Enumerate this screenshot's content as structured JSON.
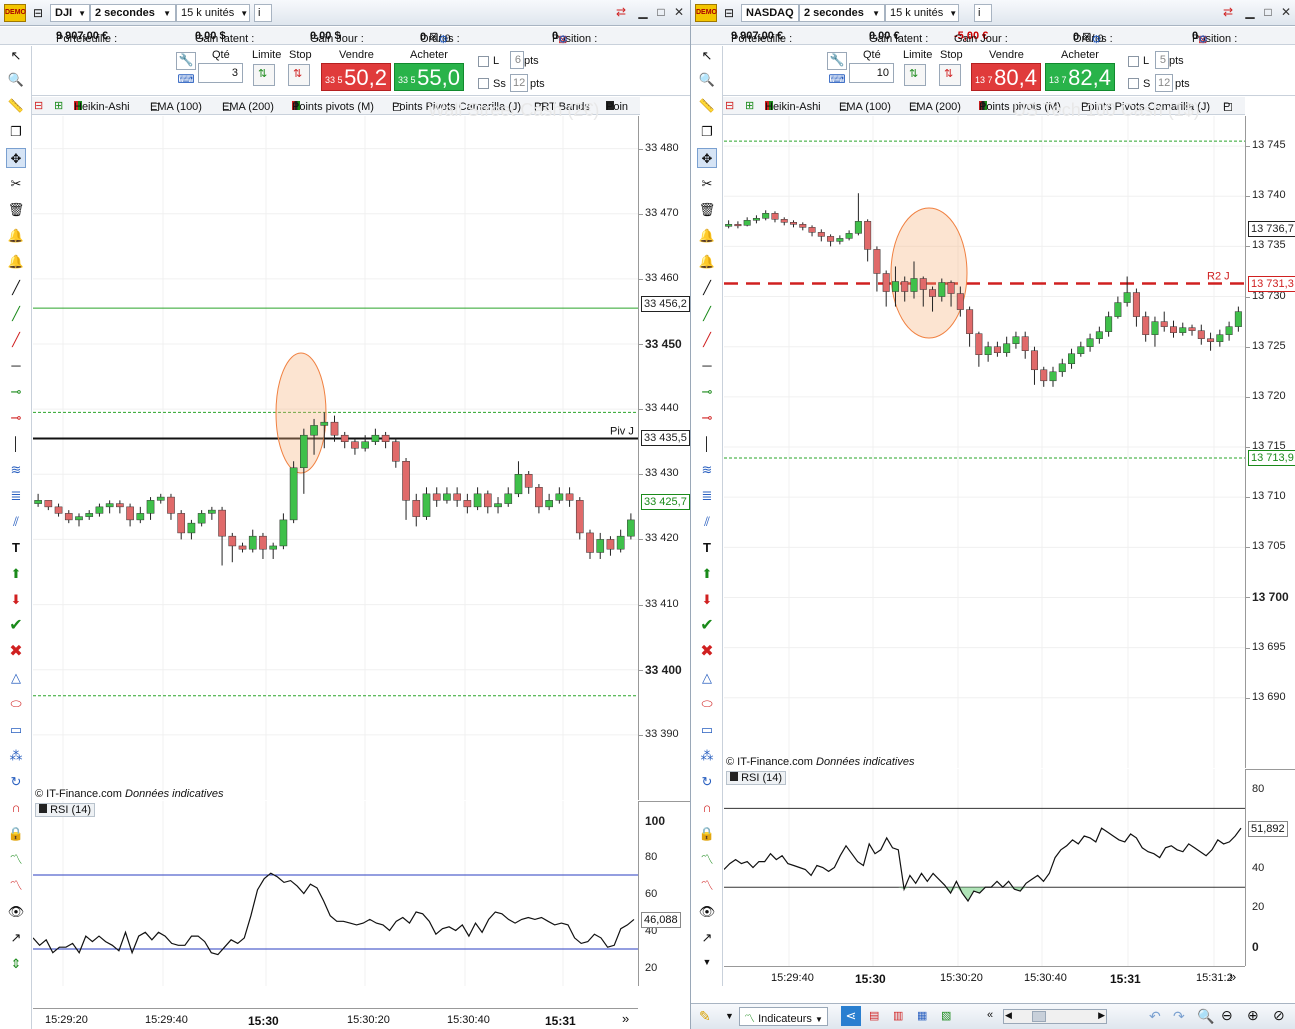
{
  "left": {
    "title": "Wall Street Cash (2€)",
    "instrument": "DJI",
    "period": "2 secondes",
    "units": "15 k unités",
    "portefeuille_label": "Portefeuille :",
    "portefeuille": "9 907,00 €",
    "gain_latent_label": "Gain latent :",
    "gain_latent": "0,00 $",
    "gain_jour_label": "Gain Jour :",
    "gain_jour": "0,00 $",
    "ordres_label": "Ordres :",
    "ordres": "0",
    "ordres2": "/ 0",
    "position_label": "Position :",
    "position": "0",
    "qte_label": "Qté",
    "qte": "3",
    "limite_label": "Limite",
    "stop_label": "Stop",
    "vendre_label": "Vendre",
    "acheter_label": "Acheter",
    "sell_small": "33 5",
    "sell_big": "50,2",
    "buy_small": "33 5",
    "buy_big": "55,0",
    "l_label": "L",
    "l_val": "6",
    "pts1": "pts",
    "ss_label": "Ss",
    "ss_val": "12",
    "pts2": "pts",
    "indicators": [
      "Heikin-Ashi",
      "EMA (100)",
      "EMA (200)",
      "Points pivots (M)",
      "Points Pivots Camarilla (J)",
      "PRT Bands",
      "Poin"
    ],
    "price_axis": [
      {
        "v": 33480,
        "t": "33 480"
      },
      {
        "v": 33470,
        "t": "33 470"
      },
      {
        "v": 33460,
        "t": "33 460"
      },
      {
        "v": 33450,
        "t": "33 450",
        "b": true
      },
      {
        "v": 33440,
        "t": "33 440"
      },
      {
        "v": 33430,
        "t": "33 430"
      },
      {
        "v": 33420,
        "t": "33 420"
      },
      {
        "v": 33410,
        "t": "33 410"
      },
      {
        "v": 33400,
        "t": "33 400",
        "b": true
      },
      {
        "v": 33390,
        "t": "33 390"
      }
    ],
    "tags": [
      {
        "v": 33456.2,
        "t": "33 456,2",
        "c": "#222"
      },
      {
        "v": 33435.5,
        "t": "33 435,5",
        "c": "#222"
      },
      {
        "v": 33425.7,
        "t": "33 425,7",
        "c": "#1a8a1a"
      }
    ],
    "pivot_label": "Piv J",
    "copyright": "© IT-Finance.com",
    "copy_italic": "Données indicatives",
    "rsi_label": "RSI (14)",
    "rsi_axis": [
      {
        "v": 100,
        "t": "100",
        "b": true
      },
      {
        "v": 80,
        "t": "80"
      },
      {
        "v": 60,
        "t": "60"
      },
      {
        "v": 40,
        "t": "40"
      },
      {
        "v": 20,
        "t": "20"
      }
    ],
    "rsi_tag": "46,088",
    "time_axis": [
      {
        "t": "15:29:20"
      },
      {
        "t": "15:29:40"
      },
      {
        "t": "15:30",
        "b": true
      },
      {
        "t": "15:30:20"
      },
      {
        "t": "15:30:40"
      },
      {
        "t": "15:31",
        "b": true
      }
    ],
    "more": "»"
  },
  "right": {
    "title": "US Tech 100 Cash (1$)",
    "instrument": "NASDAQ",
    "period": "2 secondes",
    "units": "15 k unités",
    "portefeuille_label": "Portefeuille :",
    "portefeuille": "9 907,00 €",
    "gain_latent_label": "Gain latent :",
    "gain_latent": "0,00 €",
    "gain_jour_label": "Gain Jour :",
    "gain_jour": "-5,00 €",
    "ordres_label": "Ordres :",
    "ordres": "0",
    "ordres2": "/ 0",
    "position_label": "Position :",
    "position": "0",
    "qte_label": "Qté",
    "qte": "10",
    "limite_label": "Limite",
    "stop_label": "Stop",
    "vendre_label": "Vendre",
    "acheter_label": "Acheter",
    "sell_small": "13 7",
    "sell_big": "80,4",
    "buy_small": "13 7",
    "buy_big": "82,4",
    "l_label": "L",
    "l_val": "5",
    "pts1": "pts",
    "ss_label": "S",
    "ss_val": "12",
    "pts2": "pts",
    "indicators": [
      "Heikin-Ashi",
      "EMA (100)",
      "EMA (200)",
      "Points pivots (M)",
      "Points Pivots Camarilla (J)",
      "P"
    ],
    "price_axis": [
      {
        "v": 13745,
        "t": "13 745"
      },
      {
        "v": 13740,
        "t": "13 740"
      },
      {
        "v": 13735,
        "t": "13 735"
      },
      {
        "v": 13730,
        "t": "13 730"
      },
      {
        "v": 13725,
        "t": "13 725"
      },
      {
        "v": 13720,
        "t": "13 720"
      },
      {
        "v": 13715,
        "t": "13 715"
      },
      {
        "v": 13710,
        "t": "13 710"
      },
      {
        "v": 13705,
        "t": "13 705"
      },
      {
        "v": 13700,
        "t": "13 700",
        "b": true
      },
      {
        "v": 13695,
        "t": "13 695"
      },
      {
        "v": 13690,
        "t": "13 690"
      }
    ],
    "tags": [
      {
        "v": 13736.7,
        "t": "13 736,7",
        "c": "#222"
      },
      {
        "v": 13731.3,
        "t": "13 731,3",
        "c": "#d02020"
      },
      {
        "v": 13713.9,
        "t": "13 713,9",
        "c": "#1a8a1a"
      }
    ],
    "pivot_label": "R2 J",
    "copyright": "© IT-Finance.com",
    "copy_italic": "Données indicatives",
    "rsi_label": "RSI (14)",
    "rsi_axis": [
      {
        "v": 80,
        "t": "80"
      },
      {
        "v": 60,
        "t": "60"
      },
      {
        "v": 40,
        "t": "40"
      },
      {
        "v": 20,
        "t": "20"
      },
      {
        "v": 0,
        "t": "0",
        "b": true
      }
    ],
    "rsi_tag": "51,892",
    "time_axis": [
      {
        "t": "15:29:40"
      },
      {
        "t": "15:30",
        "b": true
      },
      {
        "t": "15:30:20"
      },
      {
        "t": "15:30:40"
      },
      {
        "t": "15:31",
        "b": true
      },
      {
        "t": "15:31:2"
      }
    ],
    "more": "»",
    "indicateurs_btn": "Indicateurs"
  },
  "chart_data": [
    {
      "type": "candlestick",
      "name": "DJI Heikin-Ashi 2s",
      "y_range": [
        33380,
        33485
      ],
      "candles": [
        [
          33425.5,
          33426,
          33427,
          33425
        ],
        [
          33426,
          33425,
          33426,
          33424.5
        ],
        [
          33425,
          33424,
          33425.5,
          33423.5
        ],
        [
          33424,
          33423,
          33424.5,
          33422.5
        ],
        [
          33423,
          33423.5,
          33424,
          33422
        ],
        [
          33423.5,
          33424,
          33424.5,
          33423
        ],
        [
          33424,
          33425,
          33425.5,
          33423.5
        ],
        [
          33425,
          33425.5,
          33426,
          33424
        ],
        [
          33425.5,
          33425,
          33426,
          33424
        ],
        [
          33425,
          33423,
          33425.5,
          33422
        ],
        [
          33423,
          33424,
          33425,
          33422.5
        ],
        [
          33424,
          33426,
          33426.5,
          33423
        ],
        [
          33426,
          33426.5,
          33427,
          33425.5
        ],
        [
          33426.5,
          33424,
          33427,
          33423
        ],
        [
          33424,
          33421,
          33424.5,
          33420
        ],
        [
          33421,
          33422.5,
          33423,
          33420
        ],
        [
          33422.5,
          33424,
          33424.5,
          33422
        ],
        [
          33424,
          33424.5,
          33425,
          33423
        ],
        [
          33424.5,
          33420.5,
          33425,
          33416
        ],
        [
          33420.5,
          33419,
          33421,
          33416.5
        ],
        [
          33419,
          33418.5,
          33419.5,
          33418
        ],
        [
          33418.5,
          33420.5,
          33421.5,
          33418
        ],
        [
          33420.5,
          33418.5,
          33421,
          33417
        ],
        [
          33418.5,
          33419,
          33419.5,
          33417
        ],
        [
          33419,
          33423,
          33424,
          33418.5
        ],
        [
          33423,
          33431,
          33432,
          33422.5
        ],
        [
          33431,
          33436,
          33437,
          33427
        ],
        [
          33436,
          33437.5,
          33438.5,
          33433
        ],
        [
          33437.5,
          33438,
          33439.5,
          33434
        ],
        [
          33438,
          33436,
          33439,
          33435
        ],
        [
          33436,
          33435,
          33436.5,
          33434
        ],
        [
          33435,
          33434,
          33435.5,
          33433
        ],
        [
          33434,
          33435,
          33436,
          33433.5
        ],
        [
          33435,
          33436,
          33437,
          33434.5
        ],
        [
          33436,
          33435,
          33436.5,
          33434
        ],
        [
          33435,
          33432,
          33435.5,
          33431
        ],
        [
          33432,
          33426,
          33432.5,
          33423
        ],
        [
          33426,
          33423.5,
          33427,
          33422
        ],
        [
          33423.5,
          33427,
          33428,
          33423
        ],
        [
          33427,
          33426,
          33428,
          33425
        ],
        [
          33426,
          33427,
          33428,
          33425.5
        ],
        [
          33427,
          33426,
          33428,
          33425
        ],
        [
          33426,
          33425,
          33427,
          33424
        ],
        [
          33425,
          33427,
          33428,
          33424.5
        ],
        [
          33427,
          33425,
          33427.5,
          33424
        ],
        [
          33425,
          33425.5,
          33426.5,
          33424
        ],
        [
          33425.5,
          33427,
          33428,
          33425
        ],
        [
          33427,
          33430,
          33432,
          33426.5
        ],
        [
          33430,
          33428,
          33430.5,
          33427
        ],
        [
          33428,
          33425,
          33428.5,
          33424
        ],
        [
          33425,
          33426,
          33427,
          33424.5
        ],
        [
          33426,
          33427,
          33428,
          33425.5
        ],
        [
          33427,
          33426,
          33428,
          33425
        ],
        [
          33426,
          33421,
          33426.5,
          33420
        ],
        [
          33421,
          33418,
          33421.5,
          33417
        ],
        [
          33418,
          33420,
          33421,
          33417
        ],
        [
          33420,
          33418.5,
          33420.5,
          33417.5
        ],
        [
          33418.5,
          33420.5,
          33421.5,
          33418
        ],
        [
          33420.5,
          33423,
          33424,
          33420
        ]
      ],
      "lines": [
        {
          "label": "Piv J",
          "value": 33435.5
        },
        {
          "value": 33455.5
        },
        {
          "value": 33439.5
        },
        {
          "value": 33396
        }
      ],
      "rsi": {
        "range": [
          10,
          110
        ],
        "levels": [
          70,
          30
        ],
        "values": [
          36,
          32,
          35,
          28,
          31,
          31,
          33,
          28,
          37,
          34,
          37,
          34,
          32,
          29,
          39,
          28,
          37,
          39,
          35,
          39,
          37,
          33,
          32,
          32,
          37,
          37,
          34,
          28,
          27,
          31,
          35,
          33,
          36,
          48,
          62,
          68,
          71,
          69,
          66,
          67,
          64,
          60,
          65,
          63,
          56,
          48,
          45,
          45,
          44,
          43,
          44,
          46,
          44,
          43,
          40,
          45,
          47,
          44,
          50,
          49,
          45,
          38,
          41,
          42,
          40,
          43,
          37,
          44,
          39,
          46,
          50,
          49,
          46,
          44,
          46,
          47,
          46,
          47,
          45,
          43,
          44,
          43,
          36,
          33,
          34,
          38,
          36,
          31,
          32,
          41,
          43,
          46
        ]
      }
    },
    {
      "type": "candlestick",
      "name": "NASDAQ Heikin-Ashi 2s",
      "y_range": [
        13683,
        13748
      ],
      "candles": [
        [
          13737,
          13737.2,
          13737.6,
          13736.8
        ],
        [
          13737.2,
          13737.1,
          13737.5,
          13736.8
        ],
        [
          13737.1,
          13737.6,
          13737.9,
          13737
        ],
        [
          13737.6,
          13737.8,
          13738.1,
          13737.3
        ],
        [
          13737.8,
          13738.3,
          13738.6,
          13737.6
        ],
        [
          13738.3,
          13737.7,
          13738.5,
          13737.4
        ],
        [
          13737.7,
          13737.4,
          13737.9,
          13737.1
        ],
        [
          13737.4,
          13737.2,
          13737.6,
          13736.9
        ],
        [
          13737.2,
          13736.9,
          13737.4,
          13736.6
        ],
        [
          13736.9,
          13736.4,
          13737.1,
          13736
        ],
        [
          13736.4,
          13736,
          13736.7,
          13735.5
        ],
        [
          13736,
          13735.5,
          13736.2,
          13735
        ],
        [
          13735.5,
          13735.8,
          13736.1,
          13735.2
        ],
        [
          13735.8,
          13736.3,
          13736.6,
          13735.6
        ],
        [
          13736.3,
          13737.5,
          13740.3,
          13736.1
        ],
        [
          13737.5,
          13734.7,
          13737.7,
          13733.5
        ],
        [
          13734.7,
          13732.3,
          13735,
          13730.5
        ],
        [
          13732.3,
          13730.5,
          13732.6,
          13729
        ],
        [
          13730.5,
          13731.5,
          13733,
          13729
        ],
        [
          13731.5,
          13730.5,
          13732,
          13729.5
        ],
        [
          13730.5,
          13731.8,
          13733.5,
          13729.8
        ],
        [
          13731.8,
          13730.7,
          13732,
          13729
        ],
        [
          13730.7,
          13730,
          13731,
          13728.5
        ],
        [
          13730,
          13731.4,
          13731.8,
          13729.5
        ],
        [
          13731.4,
          13730.3,
          13731.6,
          13729
        ],
        [
          13730.3,
          13728.7,
          13731,
          13728
        ],
        [
          13728.7,
          13726.3,
          13729,
          13725
        ],
        [
          13726.3,
          13724.2,
          13726.5,
          13723
        ],
        [
          13724.2,
          13725,
          13725.5,
          13723.5
        ],
        [
          13725,
          13724.4,
          13725.5,
          13724
        ],
        [
          13724.4,
          13725.3,
          13726,
          13724
        ],
        [
          13725.3,
          13726,
          13726.5,
          13724.8
        ],
        [
          13726,
          13724.6,
          13726.5,
          13723.8
        ],
        [
          13724.6,
          13722.7,
          13725,
          13721.2
        ],
        [
          13722.7,
          13721.6,
          13723,
          13721
        ],
        [
          13721.6,
          13722.5,
          13723,
          13721
        ],
        [
          13722.5,
          13723.3,
          13723.8,
          13722
        ],
        [
          13723.3,
          13724.3,
          13724.8,
          13722.8
        ],
        [
          13724.3,
          13725,
          13725.5,
          13724
        ],
        [
          13725,
          13725.8,
          13726.3,
          13724.5
        ],
        [
          13725.8,
          13726.5,
          13727,
          13725.3
        ],
        [
          13726.5,
          13728,
          13728.5,
          13726
        ],
        [
          13728,
          13729.4,
          13730,
          13727.8
        ],
        [
          13729.4,
          13730.4,
          13732,
          13729
        ],
        [
          13730.4,
          13728,
          13730.8,
          13727
        ],
        [
          13728,
          13726.2,
          13728.5,
          13725.5
        ],
        [
          13726.2,
          13727.5,
          13728,
          13725
        ],
        [
          13727.5,
          13727,
          13728.5,
          13726.5
        ],
        [
          13727,
          13726.4,
          13727.6,
          13725.9
        ],
        [
          13726.4,
          13726.9,
          13727.4,
          13726.1
        ],
        [
          13726.9,
          13726.6,
          13727.2,
          13726.1
        ],
        [
          13726.6,
          13725.8,
          13727.2,
          13725.2
        ],
        [
          13725.8,
          13725.5,
          13726.4,
          13724.6
        ],
        [
          13725.5,
          13726.2,
          13726.7,
          13725
        ],
        [
          13726.2,
          13727,
          13727.5,
          13725.6
        ],
        [
          13727,
          13728.5,
          13729,
          13726.5
        ]
      ],
      "lines": [
        {
          "label": "R2 J",
          "value": 13731.3
        },
        {
          "value": 13745.5
        },
        {
          "value": 13713.9
        }
      ],
      "rsi": {
        "range": [
          -10,
          90
        ],
        "levels": [
          70,
          30
        ],
        "values": [
          39,
          42,
          44,
          42,
          43,
          40,
          43,
          43,
          47,
          44,
          46,
          42,
          41,
          40,
          39,
          36,
          41,
          40,
          38,
          40,
          46,
          51,
          47,
          43,
          41,
          52,
          47,
          49,
          55,
          50,
          49,
          29,
          36,
          32,
          37,
          33,
          37,
          34,
          31,
          27,
          33,
          27,
          23,
          28,
          27,
          30,
          30,
          33,
          30,
          33,
          29,
          28,
          32,
          34,
          36,
          33,
          37,
          45,
          49,
          51,
          54,
          52,
          56,
          55,
          53,
          60,
          58,
          56,
          54,
          53,
          57,
          55,
          50,
          48,
          47,
          45,
          50,
          51,
          49,
          48,
          52,
          50,
          48,
          46,
          49,
          54,
          52,
          53,
          56,
          60
        ]
      }
    }
  ]
}
